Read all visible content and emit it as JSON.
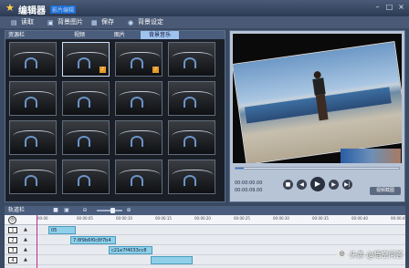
{
  "window": {
    "title": "编辑器",
    "subtitle": "影片编辑",
    "buttons": [
      "–",
      "□",
      "×"
    ]
  },
  "menu": [
    {
      "label": "读取",
      "icon": "folder-icon"
    },
    {
      "label": "背景图片",
      "icon": "image-icon"
    },
    {
      "label": "保存",
      "icon": "save-icon"
    },
    {
      "label": "背景设定",
      "icon": "settings-icon"
    }
  ],
  "resource": {
    "label": "资源栏",
    "tabs": [
      "视频",
      "图片",
      "背景音乐"
    ],
    "active_tab": 2,
    "thumb_count": 16,
    "selected_index": 1,
    "badged": [
      1,
      2
    ]
  },
  "preview": {
    "progress": 0.05,
    "time_current": "00:00:00.00",
    "time_total": "00:00:09.00",
    "controls": [
      "stop",
      "prev",
      "play",
      "next",
      "end"
    ],
    "extra_button": "视频截图"
  },
  "timeline": {
    "label": "轨道栏",
    "ruler_ticks": [
      "00:00",
      "00:00:05",
      "00:00:10",
      "00:00:15",
      "00:00:20",
      "00:00:25",
      "00:00:30",
      "00:00:35",
      "00:00:40",
      "00:00:45"
    ],
    "tracks": [
      {
        "num": "1",
        "clip": "05"
      },
      {
        "num": "2",
        "clip": "7:8f9b6f0c8f7b4"
      },
      {
        "num": "3",
        "clip": "c21e7f4033cc8"
      },
      {
        "num": "4",
        "clip": ""
      }
    ]
  },
  "watermark": "头条 @悟空问答"
}
